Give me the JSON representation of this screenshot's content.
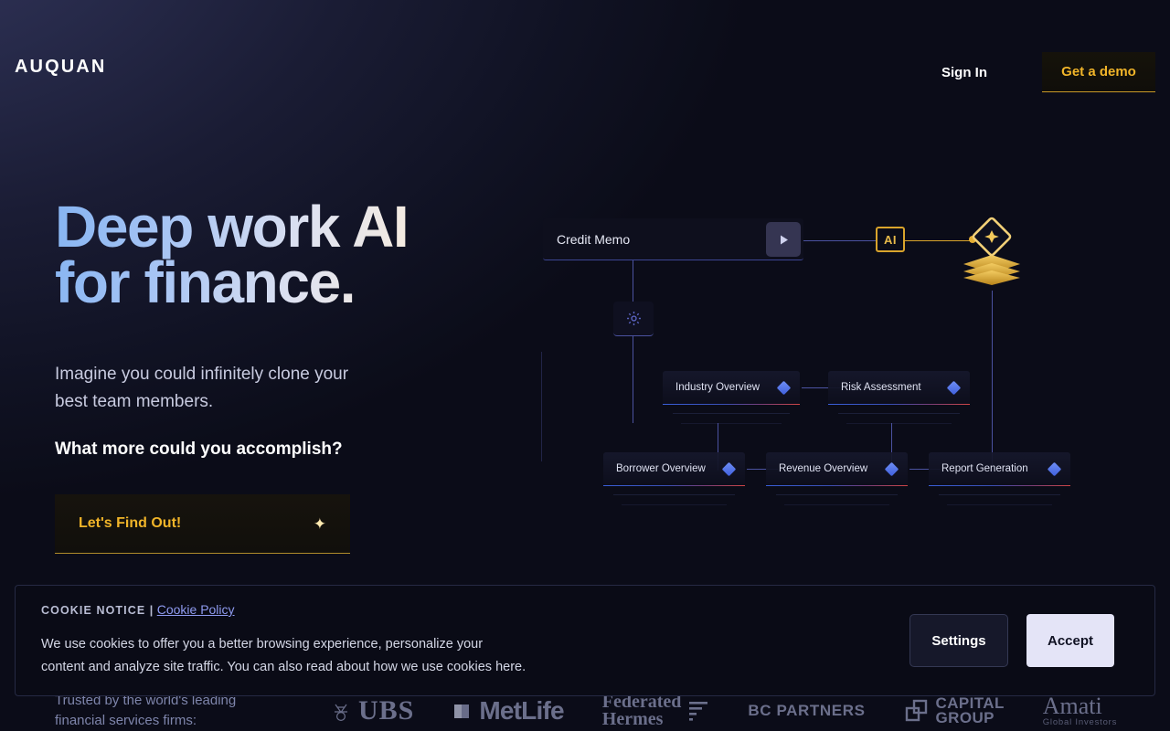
{
  "brand": {
    "logo": "AUQUAN"
  },
  "header": {
    "signin_label": "Sign In",
    "demo_label": "Get a demo",
    "accent_gold": "#f0b429"
  },
  "hero": {
    "headline": "Deep work AI\nfor finance.",
    "subtext": "Imagine you could infinitely clone your\nbest team members.",
    "question": "What more could you accomplish?",
    "cta_label": "Let's Find Out!",
    "cta_icon": "sparkle-icon"
  },
  "diagram": {
    "input_value": "Credit Memo",
    "play_icon": "play-icon",
    "gear_icon": "gear-icon",
    "ai_badge": "AI",
    "output_icon": "diamond-sparkle-stack-icon",
    "nodes": [
      {
        "label": "Industry Overview",
        "icon": "diamond-icon"
      },
      {
        "label": "Risk Assessment",
        "icon": "diamond-icon"
      },
      {
        "label": "Borrower Overview",
        "icon": "diamond-icon"
      },
      {
        "label": "Revenue Overview",
        "icon": "diamond-icon"
      },
      {
        "label": "Report Generation",
        "icon": "diamond-icon"
      }
    ]
  },
  "trusted": {
    "text": "Trusted by the world's leading\nfinancial services firms:",
    "logos": [
      {
        "name": "UBS",
        "text": "UBS"
      },
      {
        "name": "MetLife",
        "text": "MetLife"
      },
      {
        "name": "Federated Hermes",
        "text": "Federated\nHermes"
      },
      {
        "name": "BC Partners",
        "text": "BC PARTNERS"
      },
      {
        "name": "Capital Group",
        "text": "CAPITAL\nGROUP"
      },
      {
        "name": "Amati Global Investors",
        "text": "Amati"
      },
      {
        "name": "Amati tagline",
        "text": "Global Investors"
      }
    ]
  },
  "cookie": {
    "title": "COOKIE NOTICE",
    "separator": "|",
    "policy_link": "Cookie Policy",
    "body": "We use cookies to offer you a better browsing experience, personalize your\ncontent and analyze site traffic. You can also read about how we use cookies here.",
    "settings_label": "Settings",
    "accept_label": "Accept"
  }
}
